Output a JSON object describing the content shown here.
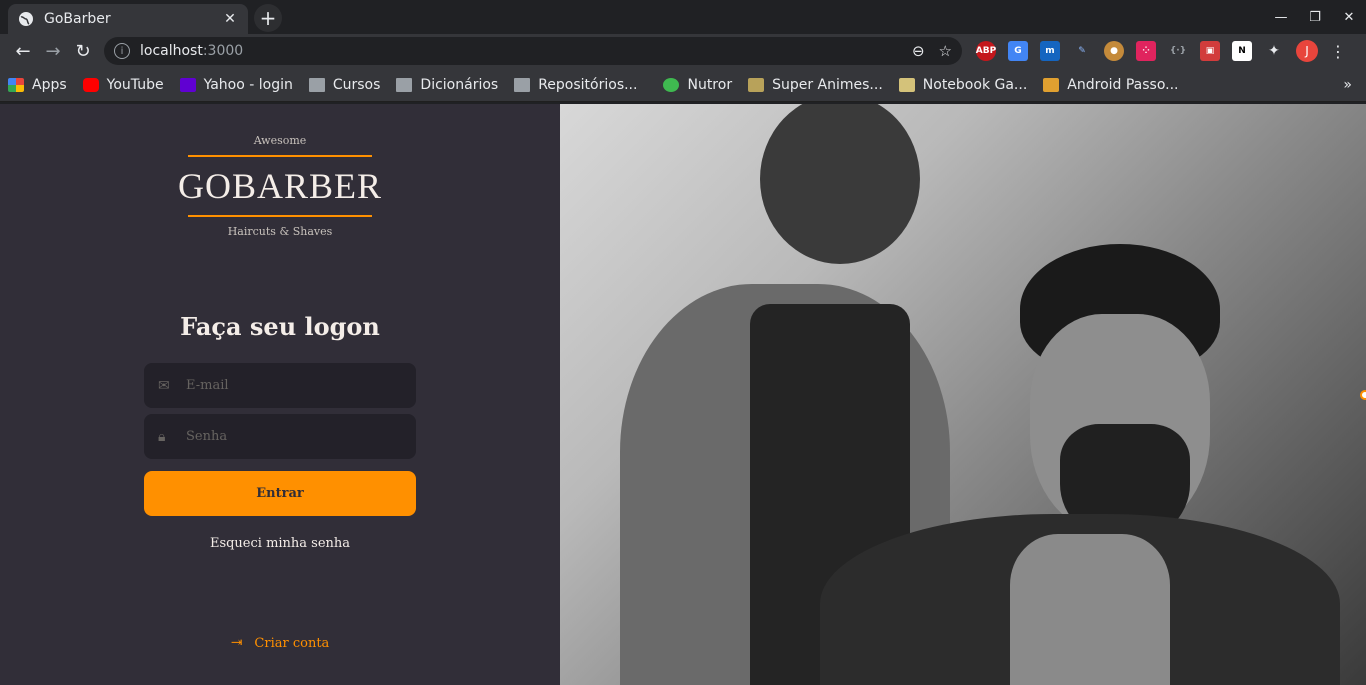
{
  "browser": {
    "tab_title": "GoBarber",
    "url_host": "localhost",
    "url_port": ":3000",
    "bookmarks": [
      {
        "label": "Apps",
        "icon": "apps-grid-icon",
        "color": "#e8453c"
      },
      {
        "label": "YouTube",
        "icon": "youtube-icon",
        "color": "#ff0000"
      },
      {
        "label": "Yahoo - login",
        "icon": "yahoo-icon",
        "color": "#6001d2"
      },
      {
        "label": "Cursos",
        "icon": "folder-icon",
        "color": "#9aa0a6"
      },
      {
        "label": "Dicionários",
        "icon": "folder-icon",
        "color": "#9aa0a6"
      },
      {
        "label": "Repositórios...",
        "icon": "folder-icon",
        "color": "#9aa0a6"
      },
      {
        "label": "Nutror",
        "icon": "nutror-icon",
        "color": "#3fb950"
      },
      {
        "label": "Super Animes...",
        "icon": "super-animes-icon",
        "color": "#b8a25a"
      },
      {
        "label": "Notebook Ga...",
        "icon": "notebook-icon",
        "color": "#d4c27a"
      },
      {
        "label": "Android Passo...",
        "icon": "android-icon",
        "color": "#e0a030"
      }
    ],
    "profile_initial": "J"
  },
  "logo": {
    "top_text": "Awesome",
    "brand": "GOBARBER",
    "bottom_text": "Haircuts & Shaves"
  },
  "form": {
    "title": "Faça seu logon",
    "email_placeholder": "E-mail",
    "password_placeholder": "Senha",
    "submit_label": "Entrar",
    "forgot_label": "Esqueci minha senha",
    "create_account_label": "Criar conta"
  },
  "colors": {
    "accent": "#ff9000",
    "panel_bg": "#312e38",
    "input_bg": "#232129",
    "text": "#f4ede8"
  }
}
